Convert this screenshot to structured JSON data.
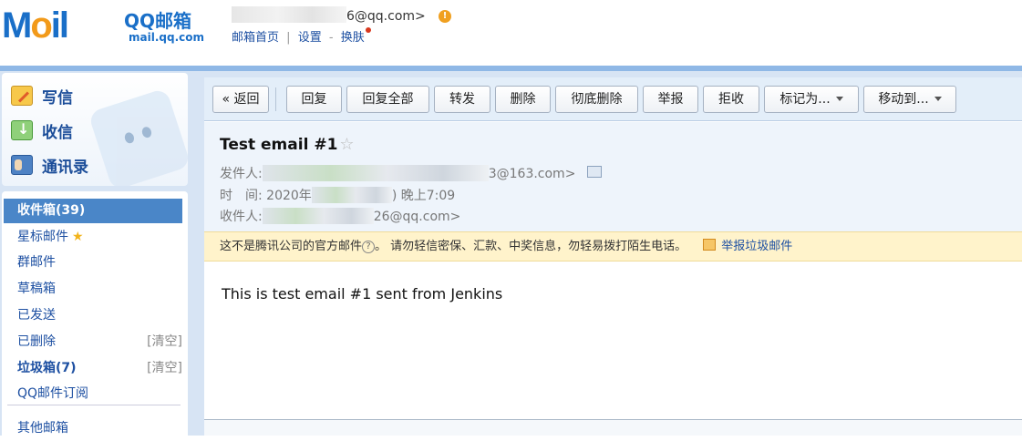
{
  "header": {
    "logo_text": "M",
    "logo_o": "o",
    "logo_il": "il",
    "logo_qq": "QQ邮箱",
    "logo_url": "mail.qq.com",
    "user_email_suffix": "6@qq.com>",
    "warning_glyph": "!",
    "links": [
      "邮箱首页",
      "设置",
      "换肤"
    ],
    "separators": [
      "|",
      "-"
    ]
  },
  "sidebar": {
    "main_actions": [
      {
        "label": "写信",
        "icon": "pencil-paper-icon"
      },
      {
        "label": "收信",
        "icon": "inbox-download-icon"
      },
      {
        "label": "通讯录",
        "icon": "contacts-card-icon"
      }
    ],
    "folders": [
      {
        "label": "收件箱(39)",
        "active": true
      },
      {
        "label": "星标邮件",
        "star": "★"
      },
      {
        "label": "群邮件"
      },
      {
        "label": "草稿箱"
      },
      {
        "label": "已发送"
      },
      {
        "label": "已删除",
        "action": "[清空]"
      },
      {
        "label": "垃圾箱(7)",
        "action": "[清空]"
      },
      {
        "label": "QQ邮件订阅"
      },
      {
        "label": "其他邮箱"
      }
    ]
  },
  "toolbar": {
    "buttons": [
      "« 返回",
      "回复",
      "回复全部",
      "转发",
      "删除",
      "彻底删除",
      "举报",
      "拒收",
      "标记为...",
      "移动到..."
    ]
  },
  "mail": {
    "subject": "Test email #1",
    "star_glyph": "☆",
    "sender_label": "发件人:",
    "sender_value": "3@163.com>",
    "time_label": "时　间:",
    "time_value_prefix": "2020年",
    "time_value_suffix": ") 晚上7:09",
    "recipient_label": "收件人:",
    "recipient_value": "26@qq.com>",
    "notice_text_1": "这不是腾讯公司的官方邮件",
    "notice_qmark": "?",
    "notice_text_2": "。  请勿轻信密保、汇款、中奖信息，勿轻易拨打陌生电话。",
    "report_link": "举报垃圾邮件",
    "body": "This is test email #1 sent from Jenkins"
  },
  "colors": {
    "brand_blue": "#1a6fc8",
    "sidebar_active": "#4a86c8",
    "notice_bg": "#fff3cb",
    "link": "#1e50a2"
  }
}
